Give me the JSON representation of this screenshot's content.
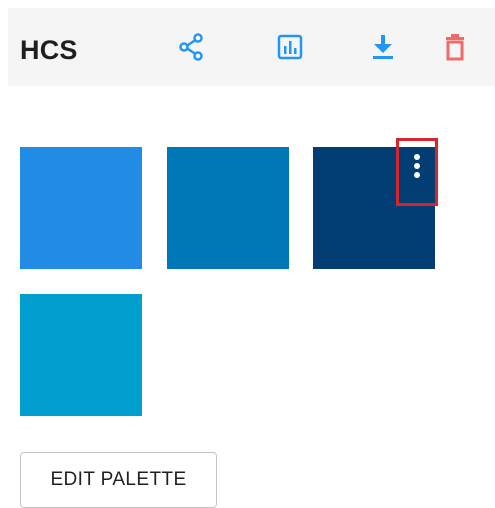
{
  "toolbar": {
    "title": "HCS",
    "icons": {
      "share": "share-icon",
      "chart": "bar-chart-icon",
      "download": "download-icon",
      "delete": "trash-icon"
    },
    "colors": {
      "icon_blue": "#2196f3",
      "icon_red": "#f06a6a",
      "background": "#f5f5f5"
    }
  },
  "palette": {
    "swatches": [
      {
        "color": "#228be6"
      },
      {
        "color": "#0077b6"
      },
      {
        "color": "#023e73"
      },
      {
        "color": "#009fd0"
      }
    ],
    "menu_icon": "more-vertical-icon",
    "highlight_color": "#d7252e"
  },
  "actions": {
    "edit_palette_label": "EDIT PALETTE"
  }
}
